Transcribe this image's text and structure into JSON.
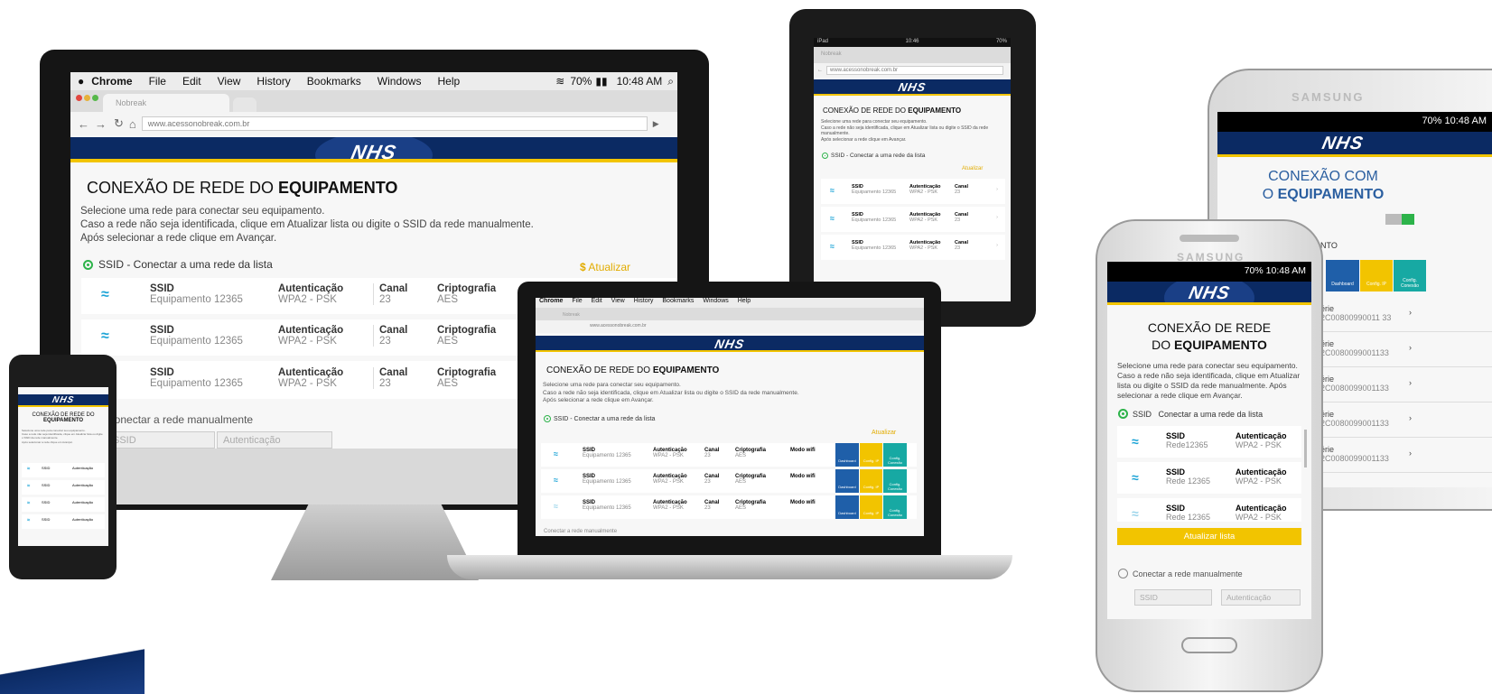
{
  "browser": {
    "menu": [
      "Chrome",
      "File",
      "Edit",
      "View",
      "History",
      "Bookmarks",
      "Windows",
      "Help"
    ],
    "status": {
      "battery": "70%",
      "time": "10:48 AM"
    },
    "tab_label": "Nobreak",
    "url": "www.acessonobreak.com.br"
  },
  "brand": {
    "logo": "NHS"
  },
  "page": {
    "title_plain": "CONEXÃO DE REDE DO ",
    "title_bold": "EQUIPAMENTO",
    "desc_line1": "Selecione uma rede para conectar seu equipamento.",
    "desc_line2": "Caso a rede não seja identificada, clique em Atualizar lista ou digite o SSID da rede manualmente.",
    "desc_line3": "Após selecionar a rede clique em Avançar.",
    "ssid_option": "SSID - Conectar a uma rede da lista",
    "refresh": "Atualizar",
    "manual_option": "Conectar a rede manualmente",
    "manual_fields": [
      "SSID",
      "Autenticação"
    ],
    "columns": {
      "ssid": "SSID",
      "auth": "Autenticação",
      "channel": "Canal",
      "crypto": "Criptografia",
      "mode": "Modo wifi"
    },
    "networks": [
      {
        "name": "Equipamento 12365",
        "auth": "WPA2 - PSK",
        "channel": "23",
        "crypto": "AES"
      },
      {
        "name": "Equipamento 12365",
        "auth": "WPA2 - PSK",
        "channel": "23",
        "crypto": "AES"
      },
      {
        "name": "Equipamento 12365",
        "auth": "WPA2 - PSK",
        "channel": "23",
        "crypto": "AES"
      }
    ],
    "actions": [
      "Dashboard",
      "Config. IP",
      "Config. Conexão"
    ]
  },
  "tablet": {
    "status_left": "iPad",
    "status_time": "10:46",
    "status_battery": "70%"
  },
  "phone": {
    "brand": "SAMSUNG",
    "status": "70%  10:48 AM",
    "title_line1": "CONEXÃO DE REDE",
    "title_line2_plain": "DO ",
    "title_line2_bold": "EQUIPAMENTO",
    "desc": "Selecione uma rede para conectar seu equipamento. Caso a rede não seja identificada, clique em Atualizar lista ou digite o SSID da rede manualmente. Após selecionar a rede clique em Avançar.",
    "ssid_option": "SSID   Conectar a uma rede da lista",
    "networks": [
      {
        "ssid": "SSID",
        "name": "Rede12365",
        "auth_label": "Autenticação",
        "auth": "WPA2 - PSK"
      },
      {
        "ssid": "SSID",
        "name": "Rede 12365",
        "auth_label": "Autenticação",
        "auth": "WPA2 - PSK"
      },
      {
        "ssid": "SSID",
        "name": "Rede 12365",
        "auth_label": "Autenticação",
        "auth": "WPA2 - PSK"
      }
    ],
    "refresh_button": "Atualizar lista",
    "manual_option": "Conectar a rede manualmente",
    "manual_fields": [
      "SSID",
      "Autenticação"
    ]
  },
  "phone_back": {
    "brand": "SAMSUNG",
    "status": "70%  10:48 AM",
    "title_line1": "CONEXÃO COM",
    "title_line2_plain": "O ",
    "title_line2_bold": "EQUIPAMENTO",
    "partial_tab": "NTO",
    "actions": [
      "Dashboard",
      "Config. IP",
      "Config. Conexão"
    ],
    "serials": [
      {
        "label": "érie",
        "value": "2C00800990011 33"
      },
      {
        "label": "érie",
        "value": "2C0080099001133"
      },
      {
        "label": "érie",
        "value": "2C0080099001133"
      },
      {
        "label": "érie",
        "value": "2C0080099001133"
      },
      {
        "label": "érie",
        "value": "2C0080099001133"
      }
    ]
  },
  "colors": {
    "navy": "#0b2a63",
    "yellow": "#f2c400",
    "wifi_blue": "#1aa3d6",
    "green": "#2db34a",
    "dash_blue": "#1f5fa9",
    "teal": "#17a9a3"
  }
}
